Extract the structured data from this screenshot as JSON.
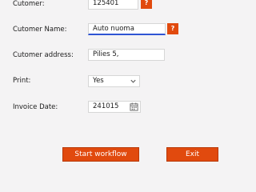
{
  "form": {
    "customer": {
      "label": "Cutomer:",
      "value": "125401",
      "help": "?"
    },
    "customer_name": {
      "label": "Cutomer Name:",
      "value": "Auto nuoma",
      "help": "?"
    },
    "customer_address": {
      "label": "Cutomer address:",
      "value": "Pilies 5,"
    },
    "print": {
      "label": "Print:",
      "value": "Yes"
    },
    "invoice_date": {
      "label": "Invoice Date:",
      "value": "241015"
    }
  },
  "buttons": {
    "start": "Start workflow",
    "exit": "Exit"
  },
  "icons": {
    "chevron": "chevron-down-icon",
    "calendar": "calendar-icon"
  },
  "colors": {
    "accent": "#e14a0e",
    "focus": "#2f55d4",
    "background": "#f4f3f4"
  }
}
